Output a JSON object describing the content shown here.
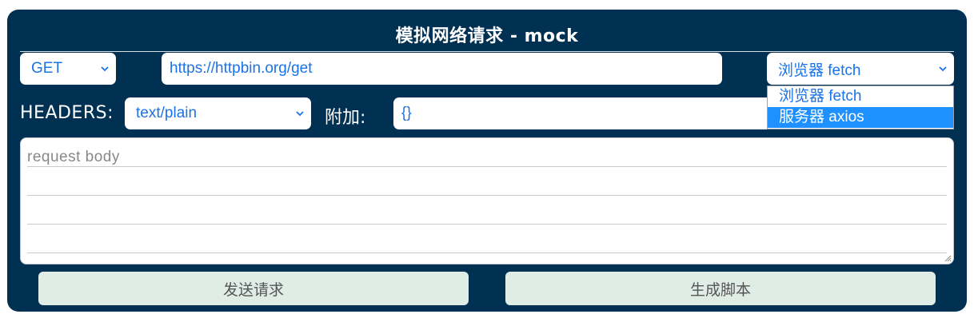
{
  "title": "模拟网络请求 - mock",
  "method": {
    "value": "GET"
  },
  "url": {
    "value": "https://httpbin.org/get"
  },
  "engine": {
    "value": "浏览器 fetch",
    "options": [
      "浏览器 fetch",
      "服务器 axios"
    ],
    "highlighted": "服务器 axios"
  },
  "headers": {
    "label": "HEADERS:",
    "content_type": "text/plain"
  },
  "extra": {
    "label": "附加:",
    "value": "{}"
  },
  "body": {
    "placeholder": "request body"
  },
  "buttons": {
    "send": "发送请求",
    "generate": "生成脚本"
  },
  "colors": {
    "panel": "#003153",
    "accent_text": "#1a73e8",
    "highlight": "#1e90ff",
    "button_bg": "#e0ece6"
  }
}
